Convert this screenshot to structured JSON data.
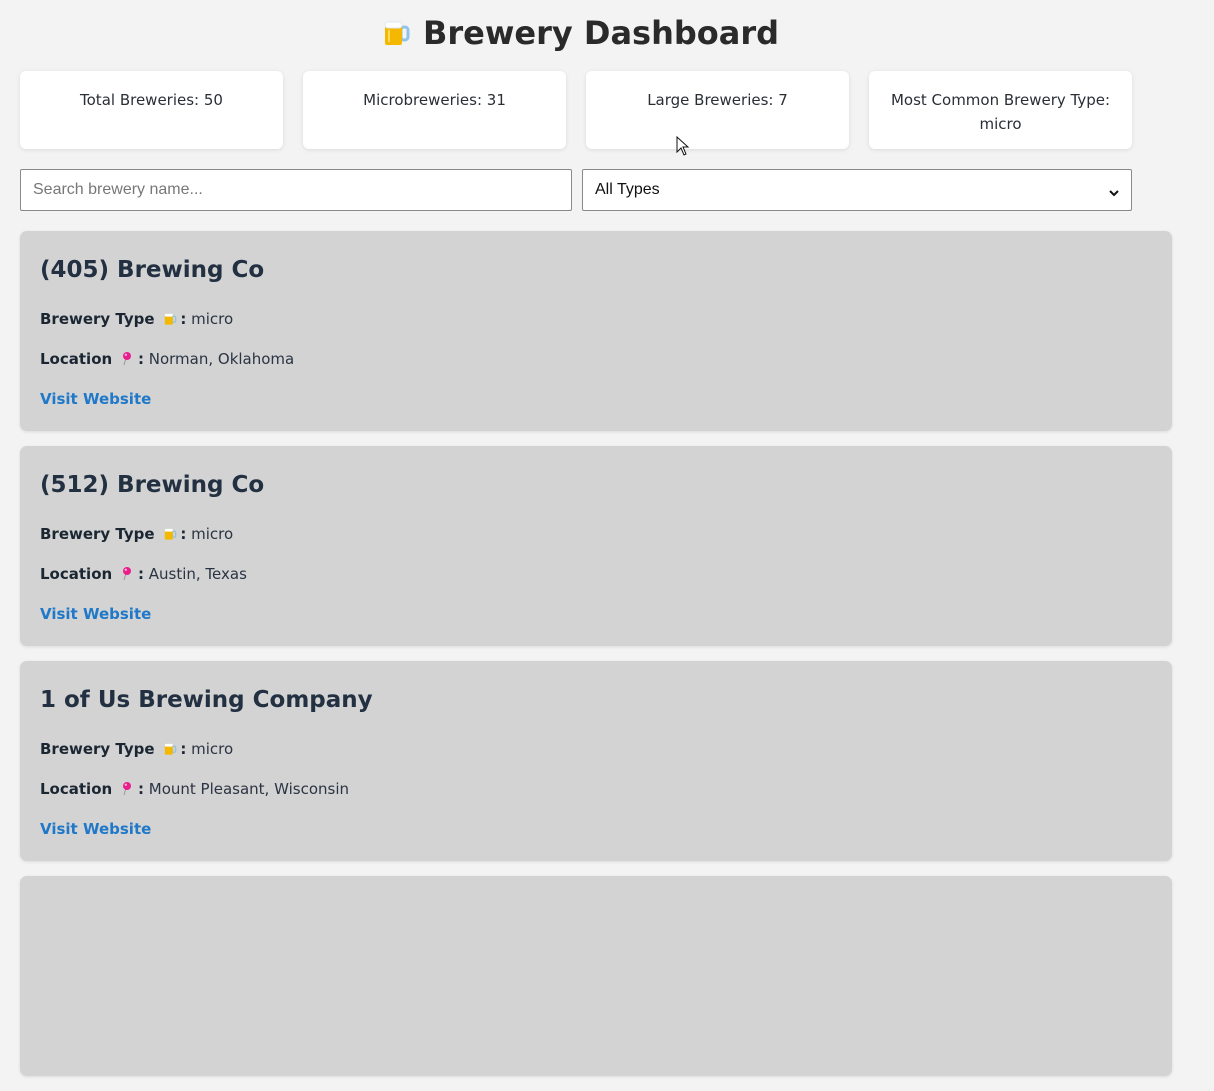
{
  "header": {
    "title": "Brewery Dashboard",
    "icon": "beer-mug-icon"
  },
  "stats": [
    {
      "label": "Total Breweries: 50"
    },
    {
      "label": "Microbreweries: 31"
    },
    {
      "label": "Large Breweries: 7"
    },
    {
      "label": "Most Common Brewery Type: micro"
    }
  ],
  "filters": {
    "search_placeholder": "Search brewery name...",
    "search_value": "",
    "type_selected": "All Types"
  },
  "labels": {
    "type_label": "Brewery Type",
    "location_label": "Location",
    "link_label": "Visit Website",
    "colon": ":"
  },
  "breweries": [
    {
      "name": "(405) Brewing Co",
      "type": "micro",
      "location": "Norman, Oklahoma"
    },
    {
      "name": "(512) Brewing Co",
      "type": "micro",
      "location": "Austin, Texas"
    },
    {
      "name": "1 of Us Brewing Company",
      "type": "micro",
      "location": "Mount Pleasant, Wisconsin"
    }
  ],
  "colors": {
    "background": "#f3f3f3",
    "card": "#d3d3d3",
    "link": "#1f78c8",
    "pin": "#e91e8c"
  }
}
